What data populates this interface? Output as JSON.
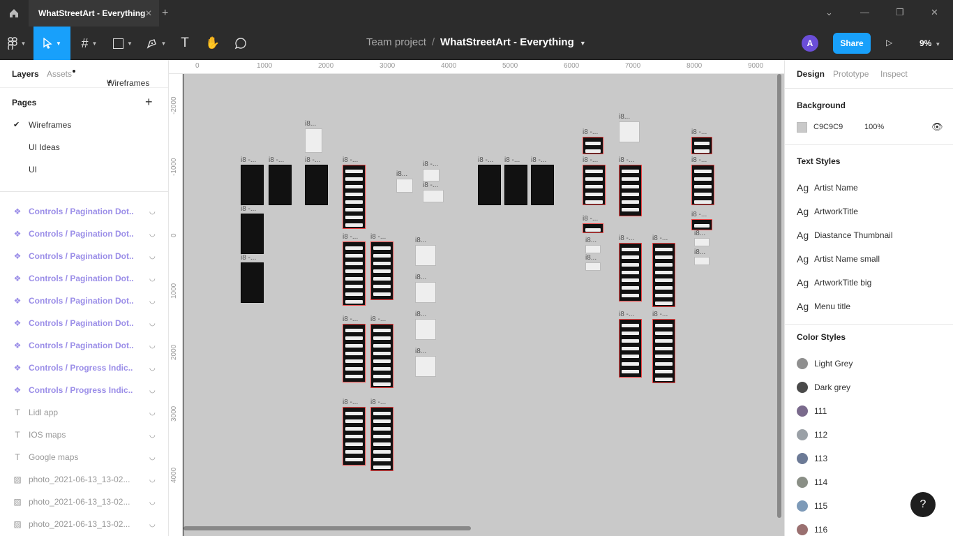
{
  "tab": {
    "title": "WhatStreetArt - Everything"
  },
  "toolbar": {
    "breadcrumb_project": "Team project",
    "breadcrumb_sep": "/",
    "file_name": "WhatStreetArt - Everything",
    "avatar_initial": "A",
    "share_label": "Share",
    "zoom": "9%"
  },
  "left": {
    "tab_layers": "Layers",
    "tab_assets": "Assets",
    "current_page": "Wireframes",
    "pages_header": "Pages",
    "pages": [
      "Wireframes",
      "UI Ideas",
      "UI"
    ],
    "layers": [
      {
        "name": "Controls / Pagination Dot...",
        "type": "component"
      },
      {
        "name": "Controls / Pagination Dot...",
        "type": "component"
      },
      {
        "name": "Controls / Pagination Dot...",
        "type": "component"
      },
      {
        "name": "Controls / Pagination Dot...",
        "type": "component"
      },
      {
        "name": "Controls / Pagination Dot...",
        "type": "component"
      },
      {
        "name": "Controls / Pagination Dot...",
        "type": "component"
      },
      {
        "name": "Controls / Pagination Dot...",
        "type": "component"
      },
      {
        "name": "Controls / Progress Indic...",
        "type": "component"
      },
      {
        "name": "Controls / Progress Indic...",
        "type": "component"
      },
      {
        "name": "Lidl app",
        "type": "text"
      },
      {
        "name": "IOS maps",
        "type": "text"
      },
      {
        "name": "Google maps",
        "type": "text"
      },
      {
        "name": "photo_2021-06-13_13-02...",
        "type": "image"
      },
      {
        "name": "photo_2021-06-13_13-02...",
        "type": "image"
      },
      {
        "name": "photo_2021-06-13_13-02...",
        "type": "image"
      }
    ]
  },
  "ruler": {
    "top": [
      "0",
      "1000",
      "2000",
      "3000",
      "4000",
      "5000",
      "6000",
      "7000",
      "8000",
      "9000"
    ],
    "left": [
      "-2000",
      "-1000",
      "0",
      "1000",
      "2000",
      "3000",
      "4000"
    ]
  },
  "canvas": {
    "frame_label": "i8 -...",
    "frame_label_short": "i8...",
    "background_hex": "#c9c9c9"
  },
  "right": {
    "tab_design": "Design",
    "tab_prototype": "Prototype",
    "tab_inspect": "Inspect",
    "background_header": "Background",
    "background_hex": "C9C9C9",
    "background_opacity": "100%",
    "text_styles_header": "Text Styles",
    "text_styles": [
      "Artist Name",
      "ArtworkTitle",
      "Diastance Thumbnail",
      "Artist Name small",
      "ArtworkTitle big",
      "Menu title"
    ],
    "ag": "Ag",
    "color_styles_header": "Color Styles",
    "color_styles": [
      {
        "name": "Light Grey",
        "color": "#8f8f8f"
      },
      {
        "name": "Dark grey",
        "color": "#4a4a4a"
      },
      {
        "name": "111",
        "color": "#7a6a8c"
      },
      {
        "name": "112",
        "color": "#9aa0a6"
      },
      {
        "name": "113",
        "color": "#6c7a96"
      },
      {
        "name": "114",
        "color": "#8a8f86"
      },
      {
        "name": "115",
        "color": "#7d9ab8"
      },
      {
        "name": "116",
        "color": "#9a7070"
      }
    ]
  },
  "help": "?"
}
